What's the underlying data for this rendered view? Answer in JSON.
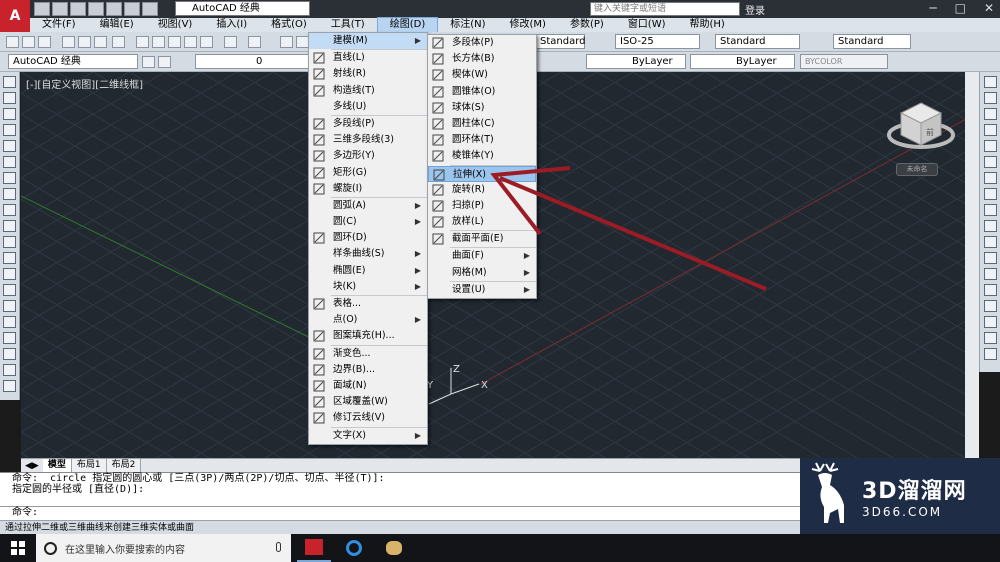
{
  "titlebar": {
    "workspace": "AutoCAD 经典",
    "search_placeholder": "键入关键字或短语",
    "login": "登录"
  },
  "menubar": {
    "items": [
      "文件(F)",
      "编辑(E)",
      "视图(V)",
      "插入(I)",
      "格式(O)",
      "工具(T)",
      "绘图(D)",
      "标注(N)",
      "修改(M)",
      "参数(P)",
      "窗口(W)",
      "帮助(H)"
    ],
    "active_index": 6
  },
  "toolbar": {
    "text_style": "Standard",
    "dim_style": "ISO-25",
    "table_style": "Standard",
    "multileader_style": "Standard",
    "workspace_combo": "AutoCAD 经典",
    "layer": "0",
    "color": "ByLayer",
    "linetype": "ByLayer",
    "plotstyle": "BYCOLOR"
  },
  "viewport": {
    "label": "[-][自定义视图][二维线框]",
    "axis_x": "X",
    "axis_y": "Y",
    "axis_z": "Z",
    "viewcube_face": "前",
    "wcs": "未命名"
  },
  "draw_menu": [
    {
      "label": "建模(M)",
      "submenu": true,
      "icon": "none",
      "state": "highlight"
    },
    {
      "sep": true
    },
    {
      "label": "直线(L)",
      "icon": "line-icon"
    },
    {
      "label": "射线(R)",
      "icon": "ray-icon"
    },
    {
      "label": "构造线(T)",
      "icon": "xline-icon"
    },
    {
      "label": "多线(U)",
      "icon": "none"
    },
    {
      "sep": true
    },
    {
      "label": "多段线(P)",
      "icon": "polyline-icon"
    },
    {
      "label": "三维多段线(3)",
      "icon": "3dpolyline-icon"
    },
    {
      "label": "多边形(Y)",
      "icon": "polygon-icon"
    },
    {
      "label": "矩形(G)",
      "icon": "rectangle-icon"
    },
    {
      "label": "螺旋(I)",
      "icon": "helix-icon"
    },
    {
      "sep": true
    },
    {
      "label": "圆弧(A)",
      "submenu": true,
      "icon": "none"
    },
    {
      "label": "圆(C)",
      "submenu": true,
      "icon": "none"
    },
    {
      "label": "圆环(D)",
      "icon": "donut-icon"
    },
    {
      "label": "样条曲线(S)",
      "submenu": true,
      "icon": "none"
    },
    {
      "label": "椭圆(E)",
      "submenu": true,
      "icon": "none"
    },
    {
      "label": "块(K)",
      "submenu": true,
      "icon": "none"
    },
    {
      "sep": true
    },
    {
      "label": "表格...",
      "icon": "table-icon"
    },
    {
      "label": "点(O)",
      "submenu": true,
      "icon": "none"
    },
    {
      "label": "图案填充(H)...",
      "icon": "hatch-icon"
    },
    {
      "sep": true
    },
    {
      "label": "渐变色...",
      "icon": "gradient-icon"
    },
    {
      "label": "边界(B)...",
      "icon": "boundary-icon"
    },
    {
      "label": "面域(N)",
      "icon": "region-icon"
    },
    {
      "label": "区域覆盖(W)",
      "icon": "wipeout-icon"
    },
    {
      "label": "修订云线(V)",
      "icon": "revcloud-icon"
    },
    {
      "sep": true
    },
    {
      "label": "文字(X)",
      "submenu": true,
      "icon": "none"
    }
  ],
  "modeling_menu": [
    {
      "label": "多段体(P)",
      "icon": "polysolid-icon"
    },
    {
      "label": "长方体(B)",
      "icon": "box-icon"
    },
    {
      "label": "楔体(W)",
      "icon": "wedge-icon"
    },
    {
      "label": "圆锥体(O)",
      "icon": "cone-icon"
    },
    {
      "label": "球体(S)",
      "icon": "sphere-icon"
    },
    {
      "label": "圆柱体(C)",
      "icon": "cylinder-icon"
    },
    {
      "label": "圆环体(T)",
      "icon": "torus-icon"
    },
    {
      "label": "棱锥体(Y)",
      "icon": "pyramid-icon"
    },
    {
      "sep": true
    },
    {
      "label": "拉伸(X)",
      "icon": "extrude-icon",
      "state": "selected"
    },
    {
      "label": "旋转(R)",
      "icon": "revolve-icon"
    },
    {
      "label": "扫掠(P)",
      "icon": "sweep-icon"
    },
    {
      "label": "放样(L)",
      "icon": "loft-icon"
    },
    {
      "sep": true
    },
    {
      "label": "截面平面(E)",
      "icon": "sectionplane-icon"
    },
    {
      "sep": true
    },
    {
      "label": "曲面(F)",
      "submenu": true,
      "icon": "none"
    },
    {
      "label": "网格(M)",
      "submenu": true,
      "icon": "none"
    },
    {
      "sep": true
    },
    {
      "label": "设置(U)",
      "submenu": true,
      "icon": "none"
    }
  ],
  "layout_tabs": [
    "模型",
    "布局1",
    "布局2"
  ],
  "command_history": [
    "命令: _circle 指定圆的圆心或 [三点(3P)/两点(2P)/切点、切点、半径(T)]:",
    "指定圆的半径或 [直径(D)]:"
  ],
  "command_prompt": "命令:",
  "status_text": "通过拉伸二维或三维曲线来创建三维实体或曲面",
  "taskbar": {
    "search_placeholder": "在这里输入你要搜索的内容"
  },
  "watermark": {
    "brand": "3D溜溜网",
    "url": "3D66.COM"
  },
  "colors": {
    "accent": "#9cc5ee",
    "annotation_arrow": "#9b1c24",
    "canvas": "#212830"
  }
}
